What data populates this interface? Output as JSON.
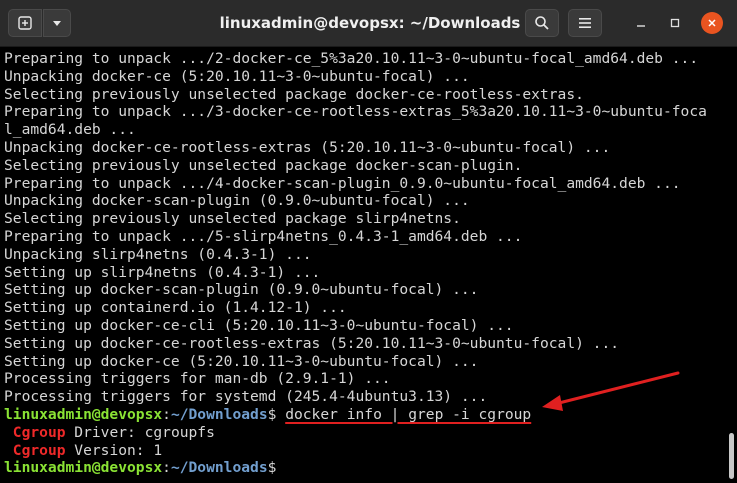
{
  "window": {
    "title": "linuxadmin@devopsx: ~/Downloads"
  },
  "colors": {
    "titlebar": "#2b2b2b",
    "background": "#000000",
    "text": "#d6d6d6",
    "prompt_user": "#8ae234",
    "prompt_path": "#729fcf",
    "grep_match": "#ef2929",
    "close_button": "#e95420",
    "annotation_arrow": "#e02020"
  },
  "terminal": {
    "output_lines": [
      "Preparing to unpack .../2-docker-ce_5%3a20.10.11~3-0~ubuntu-focal_amd64.deb ...",
      "Unpacking docker-ce (5:20.10.11~3-0~ubuntu-focal) ...",
      "Selecting previously unselected package docker-ce-rootless-extras.",
      "Preparing to unpack .../3-docker-ce-rootless-extras_5%3a20.10.11~3-0~ubuntu-foca",
      "l_amd64.deb ...",
      "Unpacking docker-ce-rootless-extras (5:20.10.11~3-0~ubuntu-focal) ...",
      "Selecting previously unselected package docker-scan-plugin.",
      "Preparing to unpack .../4-docker-scan-plugin_0.9.0~ubuntu-focal_amd64.deb ...",
      "Unpacking docker-scan-plugin (0.9.0~ubuntu-focal) ...",
      "Selecting previously unselected package slirp4netns.",
      "Preparing to unpack .../5-slirp4netns_0.4.3-1_amd64.deb ...",
      "Unpacking slirp4netns (0.4.3-1) ...",
      "Setting up slirp4netns (0.4.3-1) ...",
      "Setting up docker-scan-plugin (0.9.0~ubuntu-focal) ...",
      "Setting up containerd.io (1.4.12-1) ...",
      "Setting up docker-ce-cli (5:20.10.11~3-0~ubuntu-focal) ...",
      "Setting up docker-ce-rootless-extras (5:20.10.11~3-0~ubuntu-focal) ...",
      "Setting up docker-ce (5:20.10.11~3-0~ubuntu-focal) ...",
      "Processing triggers for man-db (2.9.1-1) ...",
      "Processing triggers for systemd (245.4-4ubuntu3.13) ..."
    ],
    "prompt_user": "linuxadmin@devopsx",
    "prompt_sep": ":",
    "prompt_path": "~/Downloads",
    "prompt_symbol": "$",
    "command": "docker info | grep -i cgroup",
    "result_1_match": "Cgroup",
    "result_1_rest": " Driver: cgroupfs",
    "result_2_match": "Cgroup",
    "result_2_rest": " Version: 1",
    "result_indent": " "
  }
}
